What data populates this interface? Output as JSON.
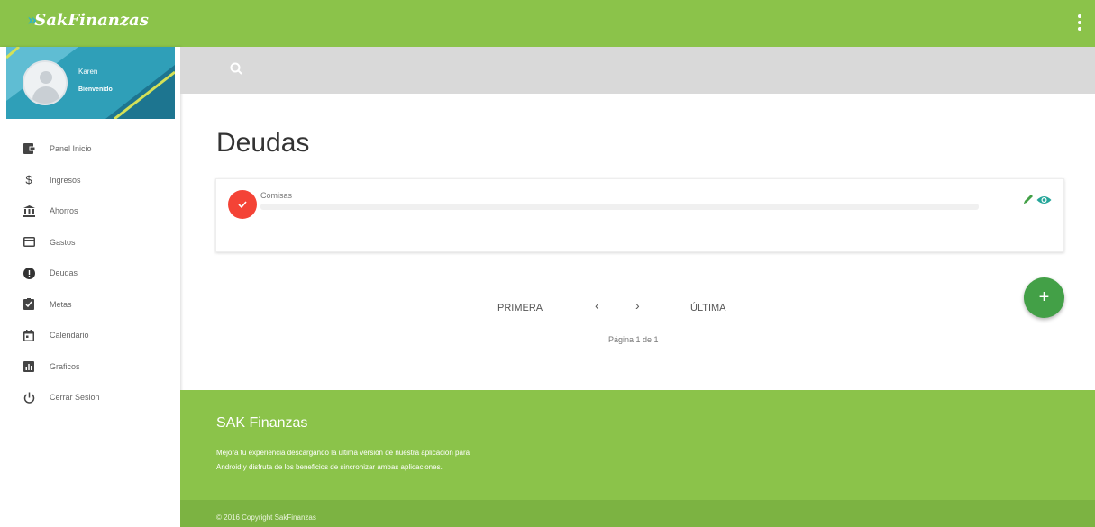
{
  "colors": {
    "primary": "#8bc34a",
    "primary_dark": "#7cb342",
    "fab": "#43a047",
    "debt_badge": "#f44336",
    "action_icon": "#26a69a"
  },
  "header": {
    "brand": "SakFinanzas",
    "menu_icon": "more-vert-icon"
  },
  "profile": {
    "name": "Karen",
    "welcome": "Bienvenido"
  },
  "sidebar": {
    "items": [
      {
        "label": "Panel Inicio",
        "icon": "wallet-icon"
      },
      {
        "label": "Ingresos",
        "icon": "dollar-icon"
      },
      {
        "label": "Ahorros",
        "icon": "bank-icon"
      },
      {
        "label": "Gastos",
        "icon": "credit-card-icon"
      },
      {
        "label": "Deudas",
        "icon": "alert-circle-icon"
      },
      {
        "label": "Metas",
        "icon": "clipboard-check-icon"
      },
      {
        "label": "Calendario",
        "icon": "calendar-icon"
      },
      {
        "label": "Graficos",
        "icon": "chart-icon"
      },
      {
        "label": "Cerrar Sesion",
        "icon": "power-icon"
      }
    ]
  },
  "search": {
    "icon": "search-icon"
  },
  "main": {
    "title": "Deudas",
    "debts": [
      {
        "name": "Comisas",
        "progress": 0
      }
    ]
  },
  "pagination": {
    "first": "PRIMERA",
    "prev": "‹",
    "next": "›",
    "last": "ÚLTIMA",
    "info": "Página 1 de 1"
  },
  "fab": {
    "label": "+"
  },
  "footer": {
    "title": "SAK Finanzas",
    "line1": "Mejora tu experiencia descargando la ultima versión de nuestra aplicación para",
    "line2": "Android y disfruta de los beneficios de sincronizar ambas aplicaciones.",
    "copyright": "© 2016 Copyright SakFinanzas"
  }
}
